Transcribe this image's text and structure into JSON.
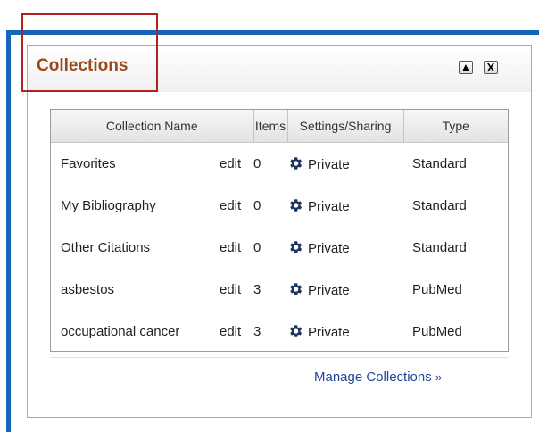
{
  "panel": {
    "title": "Collections",
    "collapse_glyph": "▲",
    "close_glyph": "X"
  },
  "table": {
    "headers": [
      "Collection Name",
      "Items",
      "Settings/Sharing",
      "Type"
    ],
    "edit_label": "edit",
    "rows": [
      {
        "name": "Favorites",
        "edit": "edit",
        "items": "0",
        "setting": "Private",
        "type": "Standard"
      },
      {
        "name": "My Bibliography",
        "edit": "edit",
        "items": "0",
        "setting": "Private",
        "type": "Standard"
      },
      {
        "name": "Other Citations",
        "edit": "edit",
        "items": "0",
        "setting": "Private",
        "type": "Standard"
      },
      {
        "name": "asbestos",
        "edit": "edit",
        "items": "3",
        "setting": "Private",
        "type": "PubMed"
      },
      {
        "name": "occupational cancer",
        "edit": "edit",
        "items": "3",
        "setting": "Private",
        "type": "PubMed"
      }
    ]
  },
  "footer": {
    "manage_label": "Manage Collections",
    "manage_arrows": "»"
  },
  "colors": {
    "frame_blue": "#1565b8",
    "title_brown": "#9a4a1a",
    "highlight_red": "#b22222",
    "link_blue": "#22449a",
    "gear_navy": "#1c3463"
  },
  "icons": {
    "settings": "gear-icon",
    "collapse": "triangle-up-icon",
    "close": "close-icon"
  }
}
